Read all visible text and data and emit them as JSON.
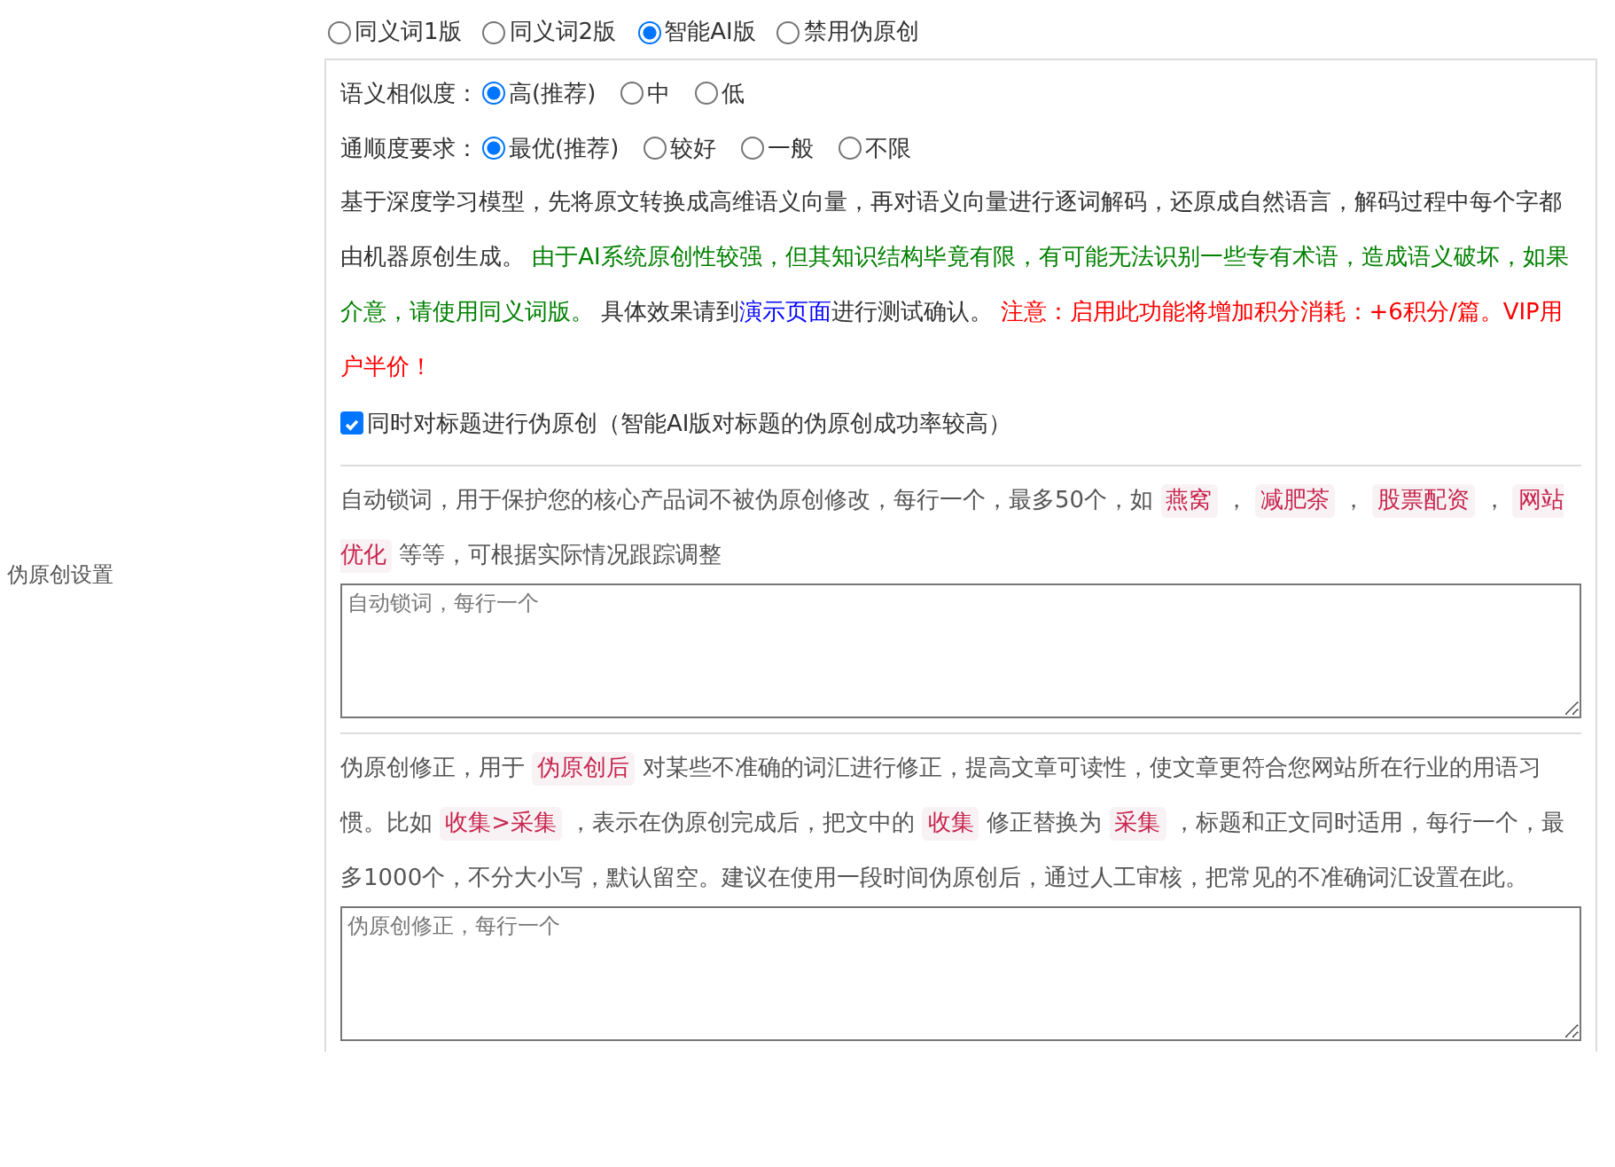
{
  "mode_options": [
    {
      "label": "同义词1版",
      "selected": false
    },
    {
      "label": "同义词2版",
      "selected": false
    },
    {
      "label": "智能AI版",
      "selected": true
    },
    {
      "label": "禁用伪原创",
      "selected": false
    }
  ],
  "side_label": "伪原创设置",
  "ai_settings": {
    "similarity": {
      "label": "语义相似度：",
      "options": [
        {
          "label": "高(推荐)",
          "selected": true
        },
        {
          "label": "中",
          "selected": false
        },
        {
          "label": "低",
          "selected": false
        }
      ]
    },
    "fluency": {
      "label": "通顺度要求：",
      "options": [
        {
          "label": "最优(推荐)",
          "selected": true
        },
        {
          "label": "较好",
          "selected": false
        },
        {
          "label": "一般",
          "selected": false
        },
        {
          "label": "不限",
          "selected": false
        }
      ]
    },
    "description": [
      {
        "kind": "plain",
        "text": "基于深度学习模型，先将原文转换成高维语义向量，再对语义向量进行逐词解码，还原成自然语言，解码过程中每个字都由机器原创生成。 "
      },
      {
        "kind": "notice",
        "text": "由于AI系统原创性较强，但其知识结构毕竟有限，有可能无法识别一些专有术语，造成语义破坏，如果介意，请使用同义词版。"
      },
      {
        "kind": "plain",
        "text": " 具体效果请到"
      },
      {
        "kind": "link",
        "text": "演示页面"
      },
      {
        "kind": "plain",
        "text": "进行测试确认。 "
      },
      {
        "kind": "warning",
        "text": "注意：启用此功能将增加积分消耗：+6积分/篇。VIP用户半价！"
      }
    ],
    "title_checkbox": {
      "label": "同时对标题进行伪原创（智能AI版对标题的伪原创成功率较高）",
      "checked": true
    }
  },
  "lock_words": {
    "description": [
      {
        "kind": "plain",
        "text": "自动锁词，用于保护您的核心产品词不被伪原创修改，每行一个，最多50个，如 "
      },
      {
        "kind": "tag",
        "text": "燕窝"
      },
      {
        "kind": "plain",
        "text": " ， "
      },
      {
        "kind": "tag",
        "text": "减肥茶"
      },
      {
        "kind": "plain",
        "text": " ， "
      },
      {
        "kind": "tag",
        "text": "股票配资"
      },
      {
        "kind": "plain",
        "text": " ， "
      },
      {
        "kind": "tag",
        "text": "网站优化"
      },
      {
        "kind": "plain",
        "text": " 等等，可根据实际情况跟踪调整"
      }
    ],
    "placeholder": "自动锁词，每行一个"
  },
  "correction": {
    "description": [
      {
        "kind": "plain",
        "text": "伪原创修正，用于 "
      },
      {
        "kind": "tag",
        "text": "伪原创后"
      },
      {
        "kind": "plain",
        "text": " 对某些不准确的词汇进行修正，提高文章可读性，使文章更符合您网站所在行业的用语习惯。比如 "
      },
      {
        "kind": "tag",
        "text": "收集>采集"
      },
      {
        "kind": "plain",
        "text": " ，表示在伪原创完成后，把文中的 "
      },
      {
        "kind": "tag",
        "text": "收集"
      },
      {
        "kind": "plain",
        "text": " 修正替换为 "
      },
      {
        "kind": "tag",
        "text": "采集"
      },
      {
        "kind": "plain",
        "text": " ，标题和正文同时适用，每行一个，最多1000个，不分大小写，默认留空。建议在使用一段时间伪原创后，通过人工审核，把常见的不准确词汇设置在此。"
      }
    ],
    "placeholder": "伪原创修正，每行一个"
  }
}
